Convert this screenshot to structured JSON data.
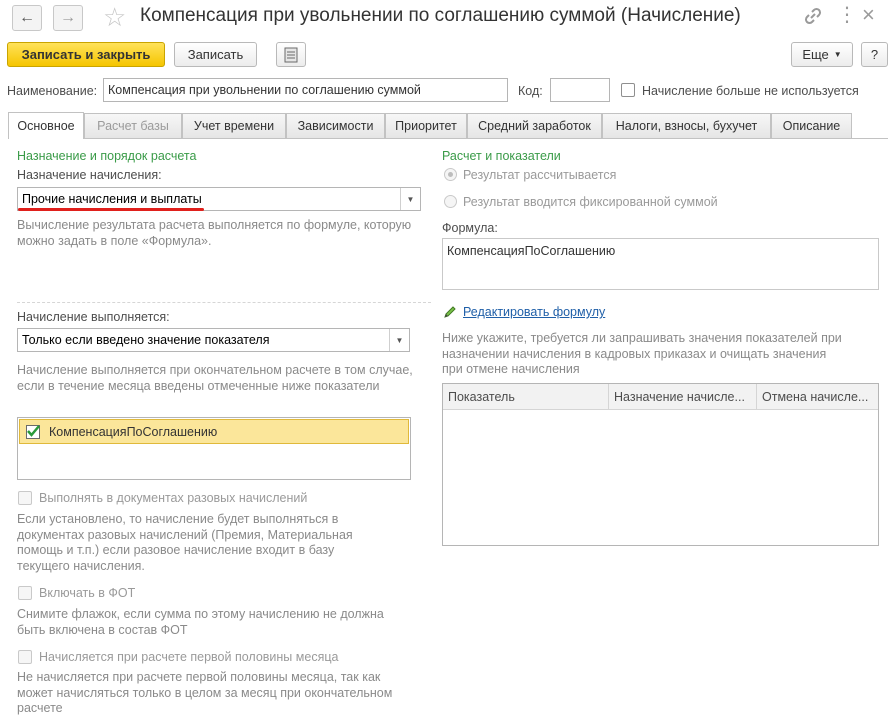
{
  "window": {
    "title": "Компенсация при увольнении по соглашению суммой (Начисление)"
  },
  "toolbar": {
    "save_close_label": "Записать и закрыть",
    "save_label": "Записать",
    "more_label": "Еще",
    "help_label": "?"
  },
  "header": {
    "name_label": "Наименование:",
    "name_value": "Компенсация при увольнении по соглашению суммой",
    "code_label": "Код:",
    "code_value": "",
    "unused_label": "Начисление больше не используется"
  },
  "tabs": [
    {
      "label": "Основное"
    },
    {
      "label": "Расчет базы"
    },
    {
      "label": "Учет времени"
    },
    {
      "label": "Зависимости"
    },
    {
      "label": "Приоритет"
    },
    {
      "label": "Средний заработок"
    },
    {
      "label": "Налоги, взносы, бухучет"
    },
    {
      "label": "Описание"
    }
  ],
  "left": {
    "purpose_section": "Назначение и порядок расчета",
    "purpose_label": "Назначение начисления:",
    "purpose_value": "Прочие начисления и выплаты",
    "purpose_hint": "Вычисление результата расчета выполняется по формуле, которую можно задать в поле «Формула».",
    "performed_label": "Начисление выполняется:",
    "performed_value": "Только если введено значение показателя",
    "performed_hint": "Начисление выполняется при окончательном расчете в том случае,\nесли в течение месяца введены отмеченные ниже показатели",
    "indicator_item": "КомпенсацияПоСоглашению",
    "one_time_label": "Выполнять в документах разовых начислений",
    "one_time_hint": "Если установлено, то начисление будет выполняться в документах разовых начислений (Премия, Материальная помощь и т.п.) если разовое начисление входит в базу текущего начисления.",
    "fot_label": "Включать в ФОТ",
    "fot_hint": "Снимите флажок, если сумма по этому начислению не должна быть включена в состав ФОТ",
    "first_half_label": "Начисляется при расчете первой половины месяца",
    "first_half_hint": "Не начисляется при расчете первой половины месяца, так как может начисляться только в целом за месяц при окончательном расчете"
  },
  "right": {
    "calc_section": "Расчет и показатели",
    "radio_calculated": "Результат рассчитывается",
    "radio_fixed": "Результат вводится фиксированной суммой",
    "formula_label": "Формула:",
    "formula_value": "КомпенсацияПоСоглашению",
    "edit_formula_link": "Редактировать формулу",
    "indicators_hint": "Ниже укажите, требуется ли запрашивать значения показателей при назначении начисления в кадровых приказах и очищать значения при отмене начисления",
    "table_columns": [
      "Показатель",
      "Назначение начисле...",
      "Отмена начисле..."
    ]
  },
  "colors": {
    "primary_button": "#f5c500",
    "section_title": "#3a9b48",
    "link": "#1f5fa8",
    "underline_mark": "#e0201c",
    "selected_row": "#fbe69a"
  }
}
